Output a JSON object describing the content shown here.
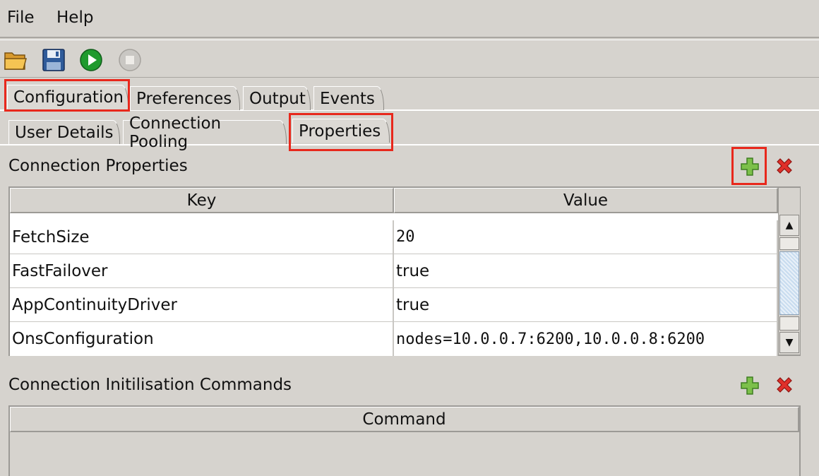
{
  "menu": {
    "file": "File",
    "help": "Help"
  },
  "toolbar": {
    "open": "folder-open-icon",
    "save": "save-disk-icon",
    "run": "play-icon",
    "stop": "stop-icon"
  },
  "tabs": {
    "main": [
      "Configuration",
      "Preferences",
      "Output",
      "Events"
    ],
    "sub": [
      "User Details",
      "Connection Pooling",
      "Properties"
    ]
  },
  "properties": {
    "title": "Connection Properties",
    "columns": [
      "Key",
      "Value"
    ],
    "rows": [
      {
        "key": "FetchSize",
        "value": "20"
      },
      {
        "key": "FastFailover",
        "value": "true"
      },
      {
        "key": "AppContinuityDriver",
        "value": "true"
      },
      {
        "key": "OnsConfiguration",
        "value": "nodes=10.0.0.7:6200,10.0.0.8:6200"
      }
    ]
  },
  "init": {
    "title": "Connection Initilisation Commands",
    "columns": [
      "Command"
    ]
  },
  "colors": {
    "highlight": "#e8281c",
    "add_green": "#5aa83a",
    "delete_red": "#e0302a",
    "run_green": "#1f9a2e"
  }
}
